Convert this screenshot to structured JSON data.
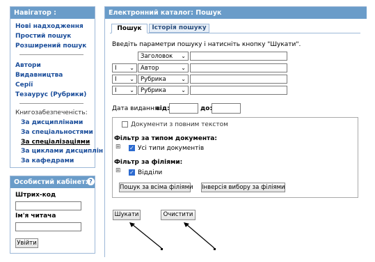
{
  "navigator": {
    "title": "Навігатор :",
    "links": [
      "Нові надходження",
      "Простий пошук",
      "Розширений пошук"
    ],
    "links2": [
      "Автори",
      "Видавництва",
      "Серії",
      "Тезаурус (Рубрики)"
    ],
    "book_section_label": "Книгозабезпеченість:",
    "book_links": [
      "За дисциплінами",
      "За спеціальностями",
      "За спеціалізаціями",
      "За циклами дисциплін",
      "За кафедрами"
    ]
  },
  "cabinet": {
    "title": "Особистий кабінет:",
    "barcode_label": "Штрих-код",
    "barcode_value": "",
    "name_label": "Ім'я читача",
    "name_value": "",
    "login_button": "Увійти",
    "help_icon": "help-icon"
  },
  "catalog": {
    "title": "Електронний каталог: Пошук",
    "tabs": [
      "Пошук",
      "Історія пошуку"
    ],
    "instructions": "Введіть параметри пошуку і натисніть кнопку \"Шукати\".",
    "rows": [
      {
        "logic": "",
        "field": "Заголовок",
        "value": ""
      },
      {
        "logic": "І",
        "field": "Автор",
        "value": ""
      },
      {
        "logic": "І",
        "field": "Рубрика",
        "value": ""
      },
      {
        "logic": "І",
        "field": "Рубрика",
        "value": ""
      }
    ],
    "date_label": "Дата видання:",
    "date_from_label": "від:",
    "date_from_value": "",
    "date_to_label": "до:",
    "date_to_value": "",
    "fulltext_label": "Документи з повним текстом",
    "fulltext_checked": false,
    "doc_filter_label": "Фільтр за типом документа:",
    "doc_filter_item": "Усі типи документів",
    "doc_filter_checked": true,
    "branch_filter_label": "Фільтр за філіями:",
    "branch_filter_item": "Відділи",
    "branch_filter_checked": true,
    "search_all_branches": "Пошук за всіма філіями",
    "invert_branches": "Інверсія вибору за філіями",
    "search_button": "Шукати",
    "clear_button": "Очистити",
    "expand_glyph": "⊞",
    "check_glyph": "✓",
    "chevron": "⌄"
  },
  "colors": {
    "header_bg": "#6a9cc9",
    "link": "#1a4d9a"
  }
}
